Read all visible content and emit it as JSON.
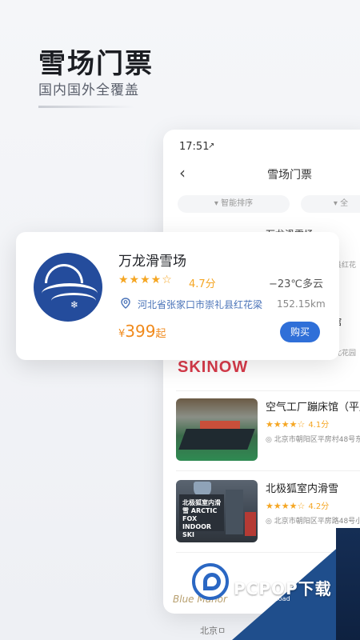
{
  "hero": {
    "title": "雪场门票",
    "subtitle": "国内国外全覆盖"
  },
  "phone": {
    "status_time": "17:51",
    "status_arrow": "↗",
    "back": "‹",
    "nav_title": "雪场门票",
    "filters": [
      "▾ 智能排序",
      "▾ 全"
    ],
    "peek_title": "万龙滑雪场",
    "peek_addr": "县红花",
    "peek_second": "馆",
    "peek_second_addr": "北花园",
    "skinow": "SKINOW",
    "items": [
      {
        "name": "空气工厂蹦床馆（平房",
        "stars": "★★★★☆",
        "score": "4.1分",
        "address": "◎ 北京市朝阳区平房村48号东"
      },
      {
        "name": "北极狐室内滑雪",
        "stars": "★★★★☆",
        "score": "4.2分",
        "address": "◎ 北京市朝阳区平房路48号小"
      }
    ],
    "thumb2_sign": "北极狐室内滑雪 ARCTIC FOX INDOOR SKI"
  },
  "card": {
    "title": "万龙滑雪场",
    "stars": "★★★★☆",
    "score": "4.7分",
    "weather": "−23℃多云",
    "address": "河北省张家口市崇礼县红花梁",
    "distance": "152.15km",
    "price_currency": "¥",
    "price_amount": "399",
    "price_suffix": "起",
    "buy_label": "购买"
  },
  "watermark": {
    "text": "PCPOP下载",
    "sub": "PCPOP Download",
    "faded_name": "Blue Manor",
    "faded_bottom": "北京ㅁ"
  },
  "colors": {
    "accent_blue": "#2f6fd8",
    "price_orange": "#f08a1c",
    "star_gold": "#f5a623",
    "skinow_red": "#d93a4a"
  },
  "icons": [
    "location-pin-icon",
    "back-arrow-icon",
    "snowflake-icon"
  ]
}
